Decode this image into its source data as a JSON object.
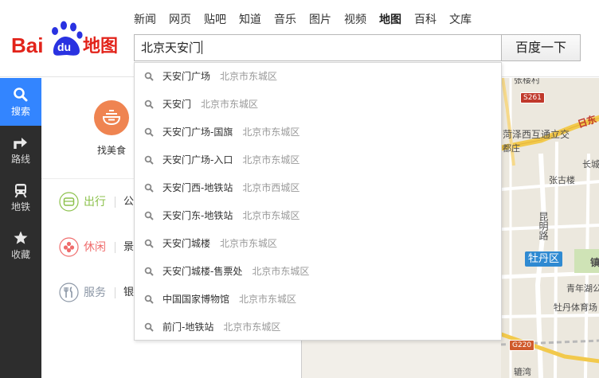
{
  "logo": {
    "text_bai": "Bai",
    "text_du": "du",
    "text_map": "地图",
    "red": "#e2231a",
    "blue": "#2932e1"
  },
  "nav": {
    "items": [
      {
        "label": "新闻",
        "active": false
      },
      {
        "label": "网页",
        "active": false
      },
      {
        "label": "贴吧",
        "active": false
      },
      {
        "label": "知道",
        "active": false
      },
      {
        "label": "音乐",
        "active": false
      },
      {
        "label": "图片",
        "active": false
      },
      {
        "label": "视频",
        "active": false
      },
      {
        "label": "地图",
        "active": true
      },
      {
        "label": "百科",
        "active": false
      },
      {
        "label": "文库",
        "active": false
      }
    ]
  },
  "search": {
    "value": "北京天安门",
    "button_label": "百度一下"
  },
  "sidebar": {
    "accent": "#3385ff",
    "items": [
      {
        "label": "搜索",
        "icon": "search-icon",
        "active": true
      },
      {
        "label": "路线",
        "icon": "route-icon",
        "active": false
      },
      {
        "label": "地铁",
        "icon": "subway-icon",
        "active": false
      },
      {
        "label": "收藏",
        "icon": "star-icon",
        "active": false
      }
    ]
  },
  "panel": {
    "food": {
      "label": "找美食",
      "icon": "food-bowl-icon",
      "color": "#ef8451"
    },
    "categories": [
      {
        "label": "出行",
        "first_item": "公",
        "icon": "car-icon",
        "color": "#8cc14c"
      },
      {
        "label": "休闲",
        "first_item": "景",
        "icon": "flower-icon",
        "color": "#ef6c6c"
      },
      {
        "label": "服务",
        "first_item": "银",
        "icon": "service-icon",
        "color": "#8c97a6"
      }
    ]
  },
  "suggestions": [
    {
      "name": "天安门广场",
      "area": "北京市东城区"
    },
    {
      "name": "天安门",
      "area": "北京市东城区"
    },
    {
      "name": "天安门广场-国旗",
      "area": "北京市东城区"
    },
    {
      "name": "天安门广场-入口",
      "area": "北京市东城区"
    },
    {
      "name": "天安门西-地铁站",
      "area": "北京市西城区"
    },
    {
      "name": "天安门东-地铁站",
      "area": "北京市东城区"
    },
    {
      "name": "天安门城楼",
      "area": "北京市东城区"
    },
    {
      "name": "天安门城楼-售票处",
      "area": "北京市东城区"
    },
    {
      "name": "中国国家博物馆",
      "area": "北京市东城区"
    },
    {
      "name": "前门-地铁站",
      "area": "北京市东城区"
    }
  ],
  "map": {
    "labels": {
      "zhangqiao": "张楼村",
      "heze": "菏泽西互通立交",
      "duzhuang": "都庄",
      "zhanggu": "张古楼",
      "kunming": "昆明路",
      "changcheng": "长城",
      "ri": "日东",
      "qingnian": "青年湖公",
      "mudan_gym": "牡丹体育场",
      "zhen": "镇",
      "yuwan": "辘湾"
    },
    "badges": {
      "s261": "S261",
      "g220": "G220"
    },
    "district": "牡丹区"
  }
}
